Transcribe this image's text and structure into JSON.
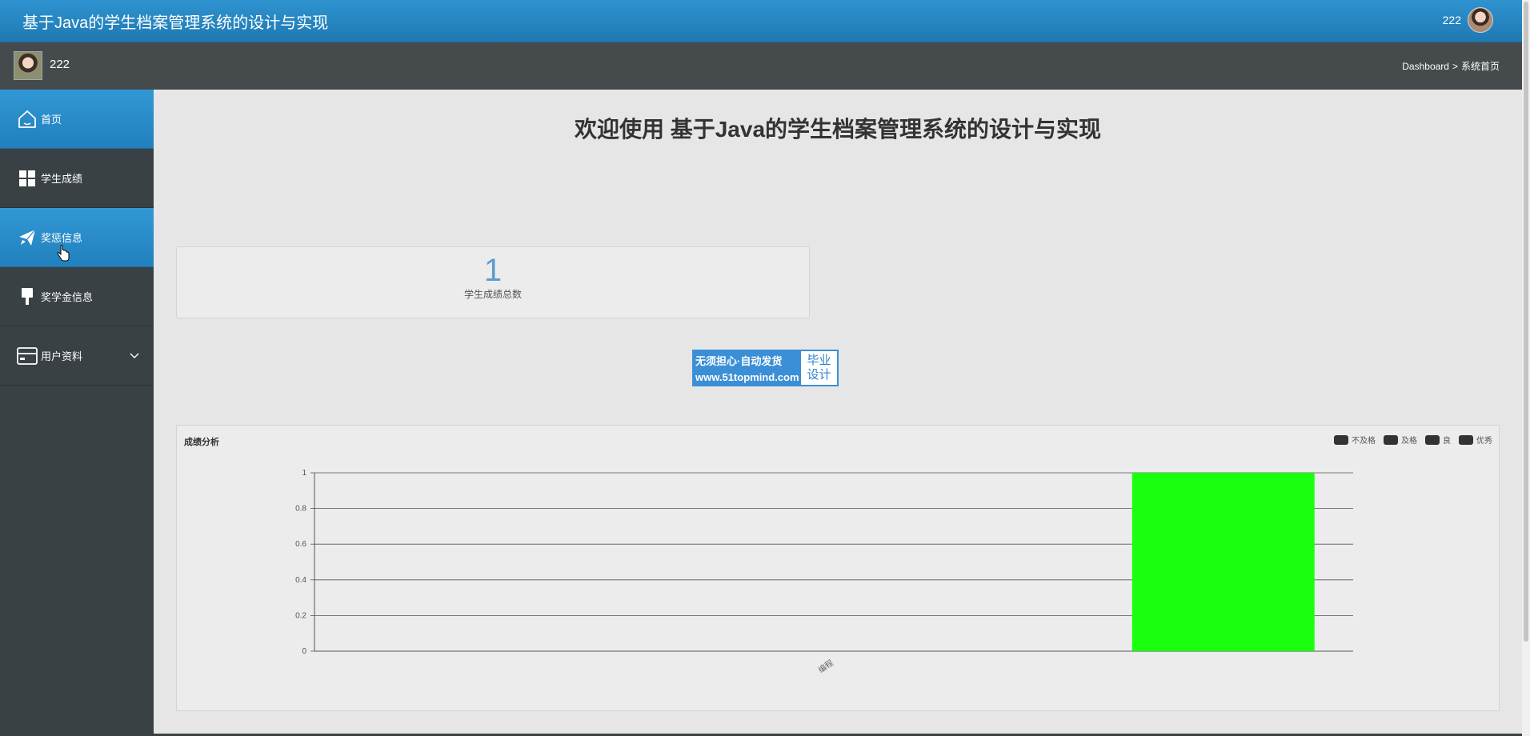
{
  "header": {
    "app_title": "基于Java的学生档案管理系统的设计与实现",
    "user_name": "222"
  },
  "subbar": {
    "user_name": "222",
    "breadcrumb": {
      "root": "Dashboard",
      "separator": ">",
      "current": "系统首页"
    }
  },
  "sidebar": {
    "items": [
      {
        "label": "首页",
        "icon": "home-icon",
        "active": true
      },
      {
        "label": "学生成绩",
        "icon": "grid-icon",
        "active": false
      },
      {
        "label": "奖惩信息",
        "icon": "paper-plane-icon",
        "active": true
      },
      {
        "label": "奖学金信息",
        "icon": "brush-icon",
        "active": false
      },
      {
        "label": "用户资料",
        "icon": "card-icon",
        "active": false,
        "expandable": true
      }
    ]
  },
  "main": {
    "welcome": "欢迎使用 基于Java的学生档案管理系统的设计与实现",
    "stat": {
      "value": "1",
      "label": "学生成绩总数"
    },
    "ad": {
      "line1": "无须担心·自动发货",
      "line2": "www.51topmind.com",
      "right1": "毕业",
      "right2": "设计"
    }
  },
  "colors": {
    "header_blue": "#2a8bc8",
    "sidebar_dark": "#3a4144",
    "accent_active": "#2b8ccb",
    "bar_green": "#1aff10",
    "stat_blue": "#5c9bd1"
  },
  "chart_data": {
    "type": "bar",
    "title": "成绩分析",
    "legend": [
      "不及格",
      "及格",
      "良",
      "优秀"
    ],
    "legend_position": "top-right",
    "categories": [
      "编程"
    ],
    "series": [
      {
        "name": "不及格",
        "values": [
          0
        ]
      },
      {
        "name": "及格",
        "values": [
          0
        ]
      },
      {
        "name": "良",
        "values": [
          0
        ]
      },
      {
        "name": "优秀",
        "values": [
          1
        ]
      }
    ],
    "ylim": [
      0,
      1
    ],
    "yticks": [
      "0",
      "0.2",
      "0.4",
      "0.6",
      "0.8",
      "1"
    ],
    "grid": true
  }
}
